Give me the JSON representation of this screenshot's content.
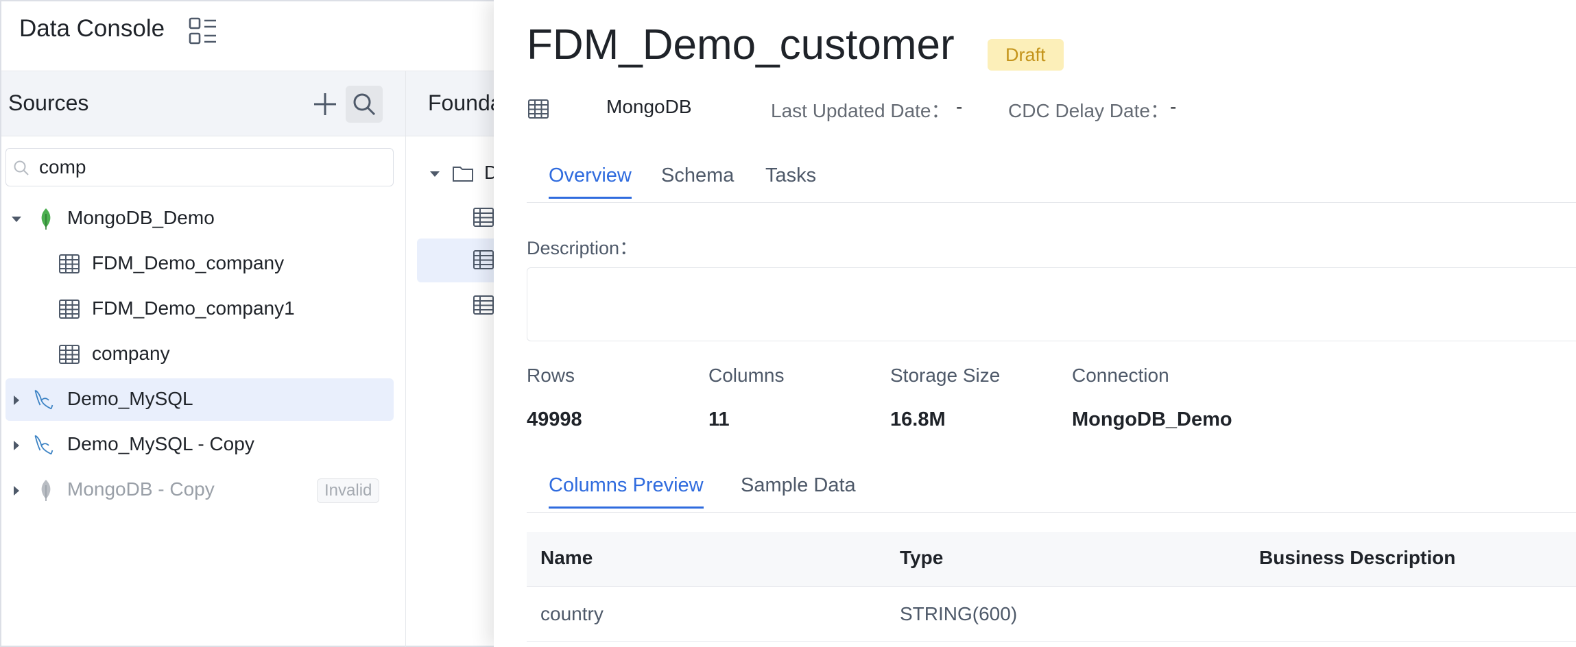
{
  "app": {
    "title": "Data Console",
    "layout_icon": "layout-list-icon"
  },
  "sources": {
    "title": "Sources",
    "add_icon": "plus-icon",
    "search_icon": "search-icon",
    "search_value": "comp",
    "tree": [
      {
        "label": "MongoDB_Demo",
        "icon": "mongodb-leaf-icon",
        "expanded": true,
        "children": [
          {
            "label": "FDM_Demo_company",
            "icon": "table-icon"
          },
          {
            "label": "FDM_Demo_company1",
            "icon": "table-icon"
          },
          {
            "label": "company",
            "icon": "table-icon"
          }
        ]
      },
      {
        "label": "Demo_MySQL",
        "icon": "mysql-dolphin-icon",
        "selected": true
      },
      {
        "label": "Demo_MySQL - Copy",
        "icon": "mysql-dolphin-icon"
      },
      {
        "label": "MongoDB - Copy",
        "icon": "mongodb-leaf-icon",
        "status": "Invalid",
        "disabled": true
      }
    ]
  },
  "foundation": {
    "title": "Foundation",
    "folder_label": "D"
  },
  "drawer": {
    "title": "FDM_Demo_customer",
    "status": "Draft",
    "status_color": "#c4941b",
    "meta": {
      "type": "MongoDB",
      "last_updated_label": "Last Updated Date：",
      "last_updated_value": "-",
      "cdc_delay_label": "CDC Delay Date：",
      "cdc_delay_value": "-"
    },
    "tabs": [
      "Overview",
      "Schema",
      "Tasks"
    ],
    "active_tab": "Overview",
    "description_label": "Description：",
    "description_value": "",
    "stats": {
      "rows_label": "Rows",
      "rows_value": "49998",
      "columns_label": "Columns",
      "columns_value": "11",
      "storage_label": "Storage Size",
      "storage_value": "16.8M",
      "connection_label": "Connection",
      "connection_value": "MongoDB_Demo"
    },
    "sub_tabs": [
      "Columns Preview",
      "Sample Data"
    ],
    "active_sub_tab": "Columns Preview",
    "columns_table": {
      "headers": [
        "Name",
        "Type",
        "Business Description"
      ],
      "rows": [
        [
          "country",
          "STRING(600)",
          ""
        ]
      ]
    }
  },
  "colors": {
    "accent": "#2f6bde",
    "selected_bg": "#e9effc",
    "draft_bg": "#fcefb9"
  }
}
